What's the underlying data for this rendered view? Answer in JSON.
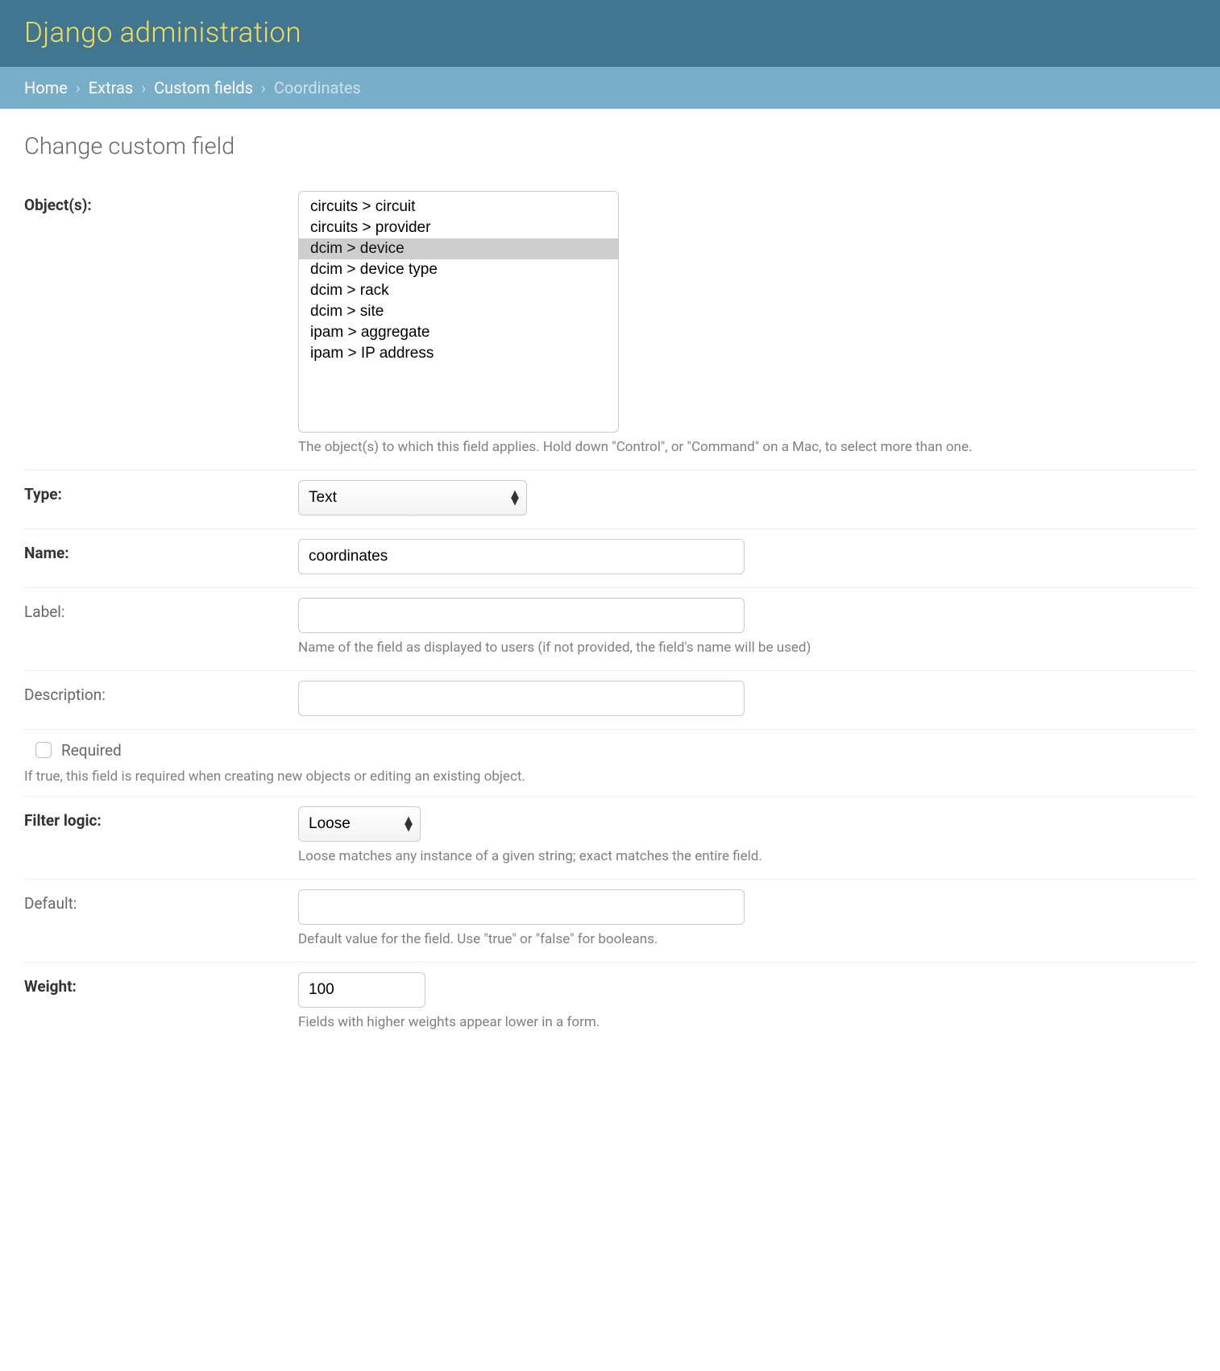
{
  "header": {
    "title": "Django administration"
  },
  "breadcrumbs": {
    "home": "Home",
    "app": "Extras",
    "model": "Custom fields",
    "current": "Coordinates"
  },
  "page_title": "Change custom field",
  "fields": {
    "objects": {
      "label": "Object(s):",
      "options": [
        "circuits > circuit",
        "circuits > provider",
        "dcim > device",
        "dcim > device type",
        "dcim > rack",
        "dcim > site",
        "ipam > aggregate",
        "ipam > IP address"
      ],
      "selected": [
        "dcim > device"
      ],
      "help": "The object(s) to which this field applies. Hold down \"Control\", or \"Command\" on a Mac, to select more than one."
    },
    "type": {
      "label": "Type:",
      "value": "Text"
    },
    "name": {
      "label": "Name:",
      "value": "coordinates"
    },
    "label_field": {
      "label": "Label:",
      "value": "",
      "help": "Name of the field as displayed to users (if not provided, the field's name will be used)"
    },
    "description": {
      "label": "Description:",
      "value": ""
    },
    "required": {
      "label": "Required",
      "checked": false,
      "help": "If true, this field is required when creating new objects or editing an existing object."
    },
    "filter_logic": {
      "label": "Filter logic:",
      "value": "Loose",
      "help": "Loose matches any instance of a given string; exact matches the entire field."
    },
    "default": {
      "label": "Default:",
      "value": "",
      "help": "Default value for the field. Use \"true\" or \"false\" for booleans."
    },
    "weight": {
      "label": "Weight:",
      "value": "100",
      "help": "Fields with higher weights appear lower in a form."
    }
  }
}
